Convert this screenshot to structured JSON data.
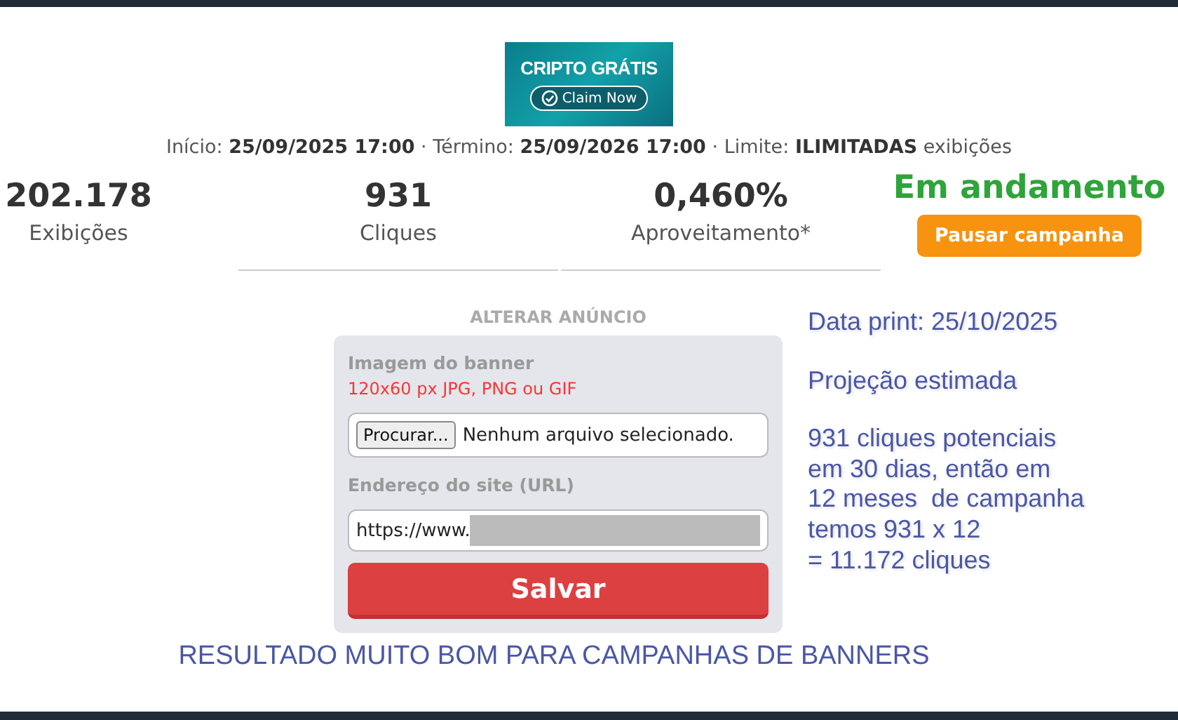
{
  "banner": {
    "title": "CRIPTO GRÁTIS",
    "button": "Claim Now"
  },
  "period": "Início: **25/09/2025 17:00** · Término: **25/09/2026 17:00** · Limite: **ILIMITADAS** exibições",
  "stats": [
    {
      "value": "202.178",
      "label": "Exibições"
    },
    {
      "value": "931",
      "label": "Cliques"
    },
    {
      "value": "0,460%",
      "label": "Aproveitamento*"
    }
  ],
  "status": "Em andamento",
  "pause_button": "Pausar campanha",
  "form": {
    "heading": "ALTERAR ANÚNCIO",
    "image_label": "Imagem do banner",
    "image_hint": "120x60 px JPG, PNG ou GIF",
    "browse_button": "Procurar...",
    "file_status": "Nenhum arquivo selecionado.",
    "url_label": "Endereço do site (URL)",
    "url_value": "https://www.",
    "save_button": "Salvar"
  },
  "note": [
    "Data print: 25/10/2025",
    "Projeção estimada",
    "931 cliques potenciais\nem 30 dias, então em\n12 meses  de campanha\ntemos 931 x 12\n= 11.172 cliques"
  ],
  "footer": "RESULTADO MUITO BOM PARA CAMPANHAS DE BANNERS"
}
